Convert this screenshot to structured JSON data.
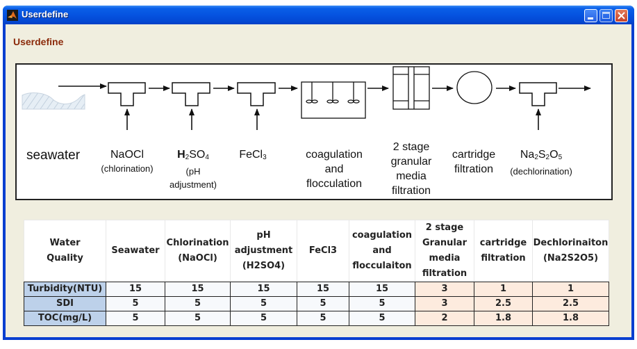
{
  "window": {
    "title": "Userdefine",
    "icon": "matlab-icon",
    "controls": [
      "minimize",
      "maximize",
      "close"
    ]
  },
  "panel": {
    "title": "Userdefine"
  },
  "diagram": {
    "source_label": "seawater",
    "stages": [
      {
        "name": "NaOCl",
        "caption": "(chlorination)",
        "equipment": "dosing-tee"
      },
      {
        "name_parts": [
          "H",
          "2",
          "SO",
          "4"
        ],
        "caption_lines": [
          "(pH",
          "adjustment)"
        ],
        "equipment": "dosing-tee"
      },
      {
        "name_parts": [
          "FeCl",
          "3"
        ],
        "equipment": "dosing-tee"
      },
      {
        "lines": [
          "coagulation",
          "and",
          "flocculation"
        ],
        "equipment": "mixing-tank"
      },
      {
        "lines": [
          "2 stage",
          "granular",
          "media",
          "filtration"
        ],
        "equipment": "granular-filter"
      },
      {
        "lines": [
          "cartridge",
          "filtration"
        ],
        "equipment": "cartridge-filter"
      },
      {
        "name_parts": [
          "Na",
          "2",
          "S",
          "2",
          "O",
          "5"
        ],
        "caption": "(dechlorination)",
        "equipment": "dosing-tee"
      }
    ]
  },
  "table": {
    "headers": [
      [
        "Water",
        "Quality"
      ],
      [
        "Seawater"
      ],
      [
        "Chlorination",
        "(NaOCl)"
      ],
      [
        "pH",
        "adjustment",
        "(H2SO4)"
      ],
      [
        "FeCl3"
      ],
      [
        "coagulation",
        "and",
        "flocculaiton"
      ],
      [
        "2 stage",
        "Granular",
        "media",
        "filtration"
      ],
      [
        "cartridge",
        "filtration"
      ],
      [
        "Dechlorinaiton",
        "(Na2S2O5)"
      ]
    ],
    "rows": [
      {
        "label": "Turbidity(NTU)",
        "values": [
          "15",
          "15",
          "15",
          "15",
          "15",
          "3",
          "1",
          "1"
        ]
      },
      {
        "label": "SDI",
        "values": [
          "5",
          "5",
          "5",
          "5",
          "5",
          "3",
          "2.5",
          "2.5"
        ]
      },
      {
        "label": "TOC(mg/L)",
        "values": [
          "5",
          "5",
          "5",
          "5",
          "5",
          "2",
          "1.8",
          "1.8"
        ]
      }
    ],
    "colors": {
      "row_header": "#bdd1ea",
      "highlight": "#fdebde",
      "normal": "#f7f9fc"
    }
  }
}
